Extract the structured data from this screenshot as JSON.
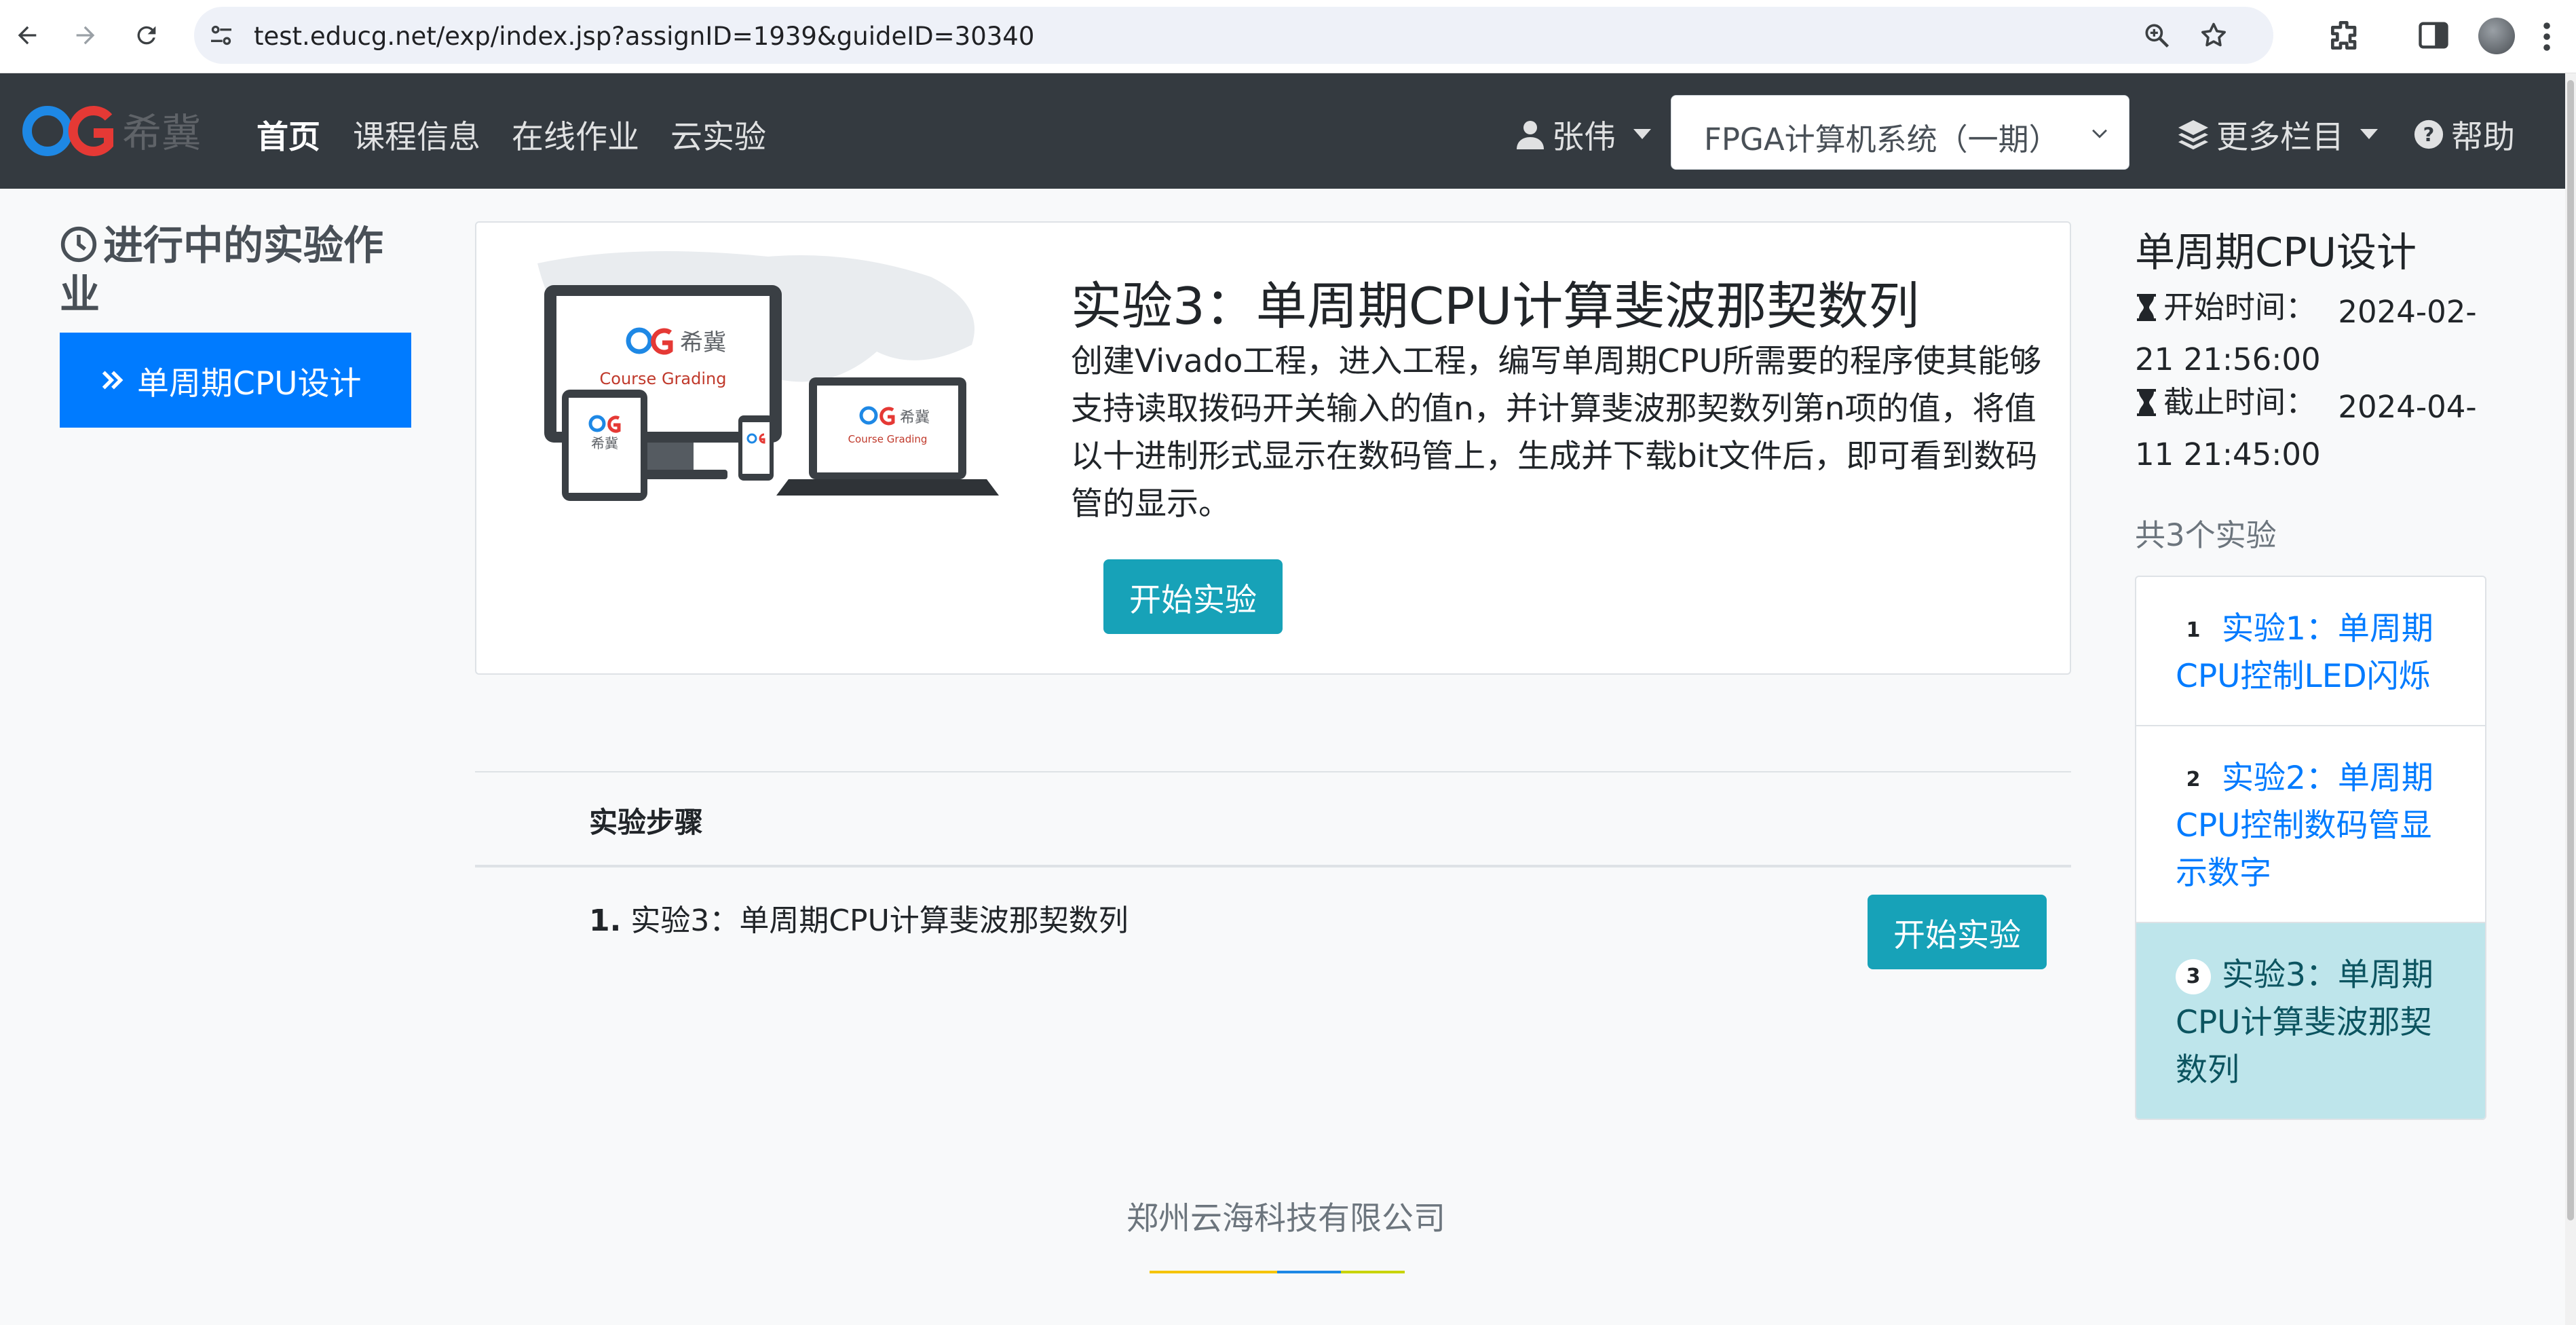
{
  "browser": {
    "url": "test.educg.net/exp/index.jsp?assignID=1939&guideID=30340"
  },
  "navbar": {
    "logo_text": "希冀",
    "items": [
      {
        "label": "首页",
        "active": true
      },
      {
        "label": "课程信息"
      },
      {
        "label": "在线作业"
      },
      {
        "label": "云实验"
      }
    ],
    "user": "张伟",
    "course_selected": "FPGA计算机系统（一期）",
    "more": "更多栏目",
    "help": "帮助"
  },
  "left": {
    "title": "进行中的实验作业",
    "button": "单周期CPU设计"
  },
  "card": {
    "title": "实验3：单周期CPU计算斐波那契数列",
    "description": "创建Vivado工程，进入工程，编写单周期CPU所需要的程序使其能够支持读取拨码开关输入的值n，并计算斐波那契数列第n项的值，将值以十进制形式显示在数码管上，生成并下载bit文件后，即可看到数码管的显示。",
    "button": "开始实验",
    "illustration": {
      "brand": "希冀",
      "tagline": "Course Grading"
    }
  },
  "steps": {
    "heading": "实验步骤",
    "items": [
      {
        "num": "1.",
        "label": "实验3：单周期CPU计算斐波那契数列",
        "button": "开始实验"
      }
    ]
  },
  "right": {
    "title": "单周期CPU设计",
    "start_label": "开始时间：",
    "start_value": "2024-02-21 21:56:00",
    "end_label": "截止时间：",
    "end_value": "2024-04-11 21:45:00",
    "count": "共3个实验",
    "experiments": [
      {
        "num": "1",
        "label": "实验1：单周期CPU控制LED闪烁",
        "active": false
      },
      {
        "num": "2",
        "label": "实验2：单周期CPU控制数码管显示数字",
        "active": false
      },
      {
        "num": "3",
        "label": "实验3：单周期CPU计算斐波那契数列",
        "active": true
      }
    ]
  },
  "footer": {
    "company": "郑州云海科技有限公司"
  },
  "colors": {
    "navbar": "#343a40",
    "primary": "#007bff",
    "info": "#17a2b8",
    "active_item": "#bee5eb"
  }
}
